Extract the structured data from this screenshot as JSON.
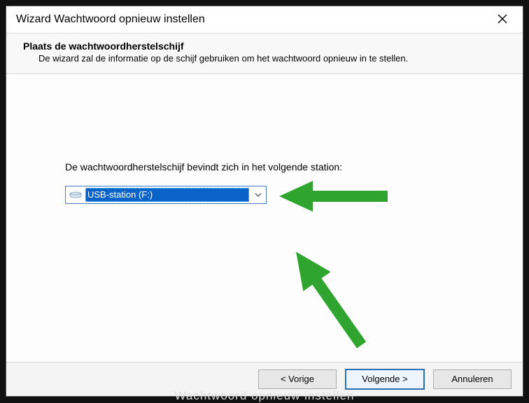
{
  "window": {
    "title": "Wizard Wachtwoord opnieuw instellen"
  },
  "header": {
    "heading": "Plaats de wachtwoordherstelschijf",
    "subheading": "De wizard zal de informatie op de schijf gebruiken om het wachtwoord opnieuw in te stellen."
  },
  "content": {
    "instruction": "De wachtwoordherstelschijf bevindt zich in het volgende station:",
    "selected_drive": "USB-station (F:)"
  },
  "footer": {
    "back": "< Vorige",
    "next": "Volgende >",
    "cancel": "Annuleren"
  },
  "background_text": "Wachtwoord opnieuw instellen"
}
